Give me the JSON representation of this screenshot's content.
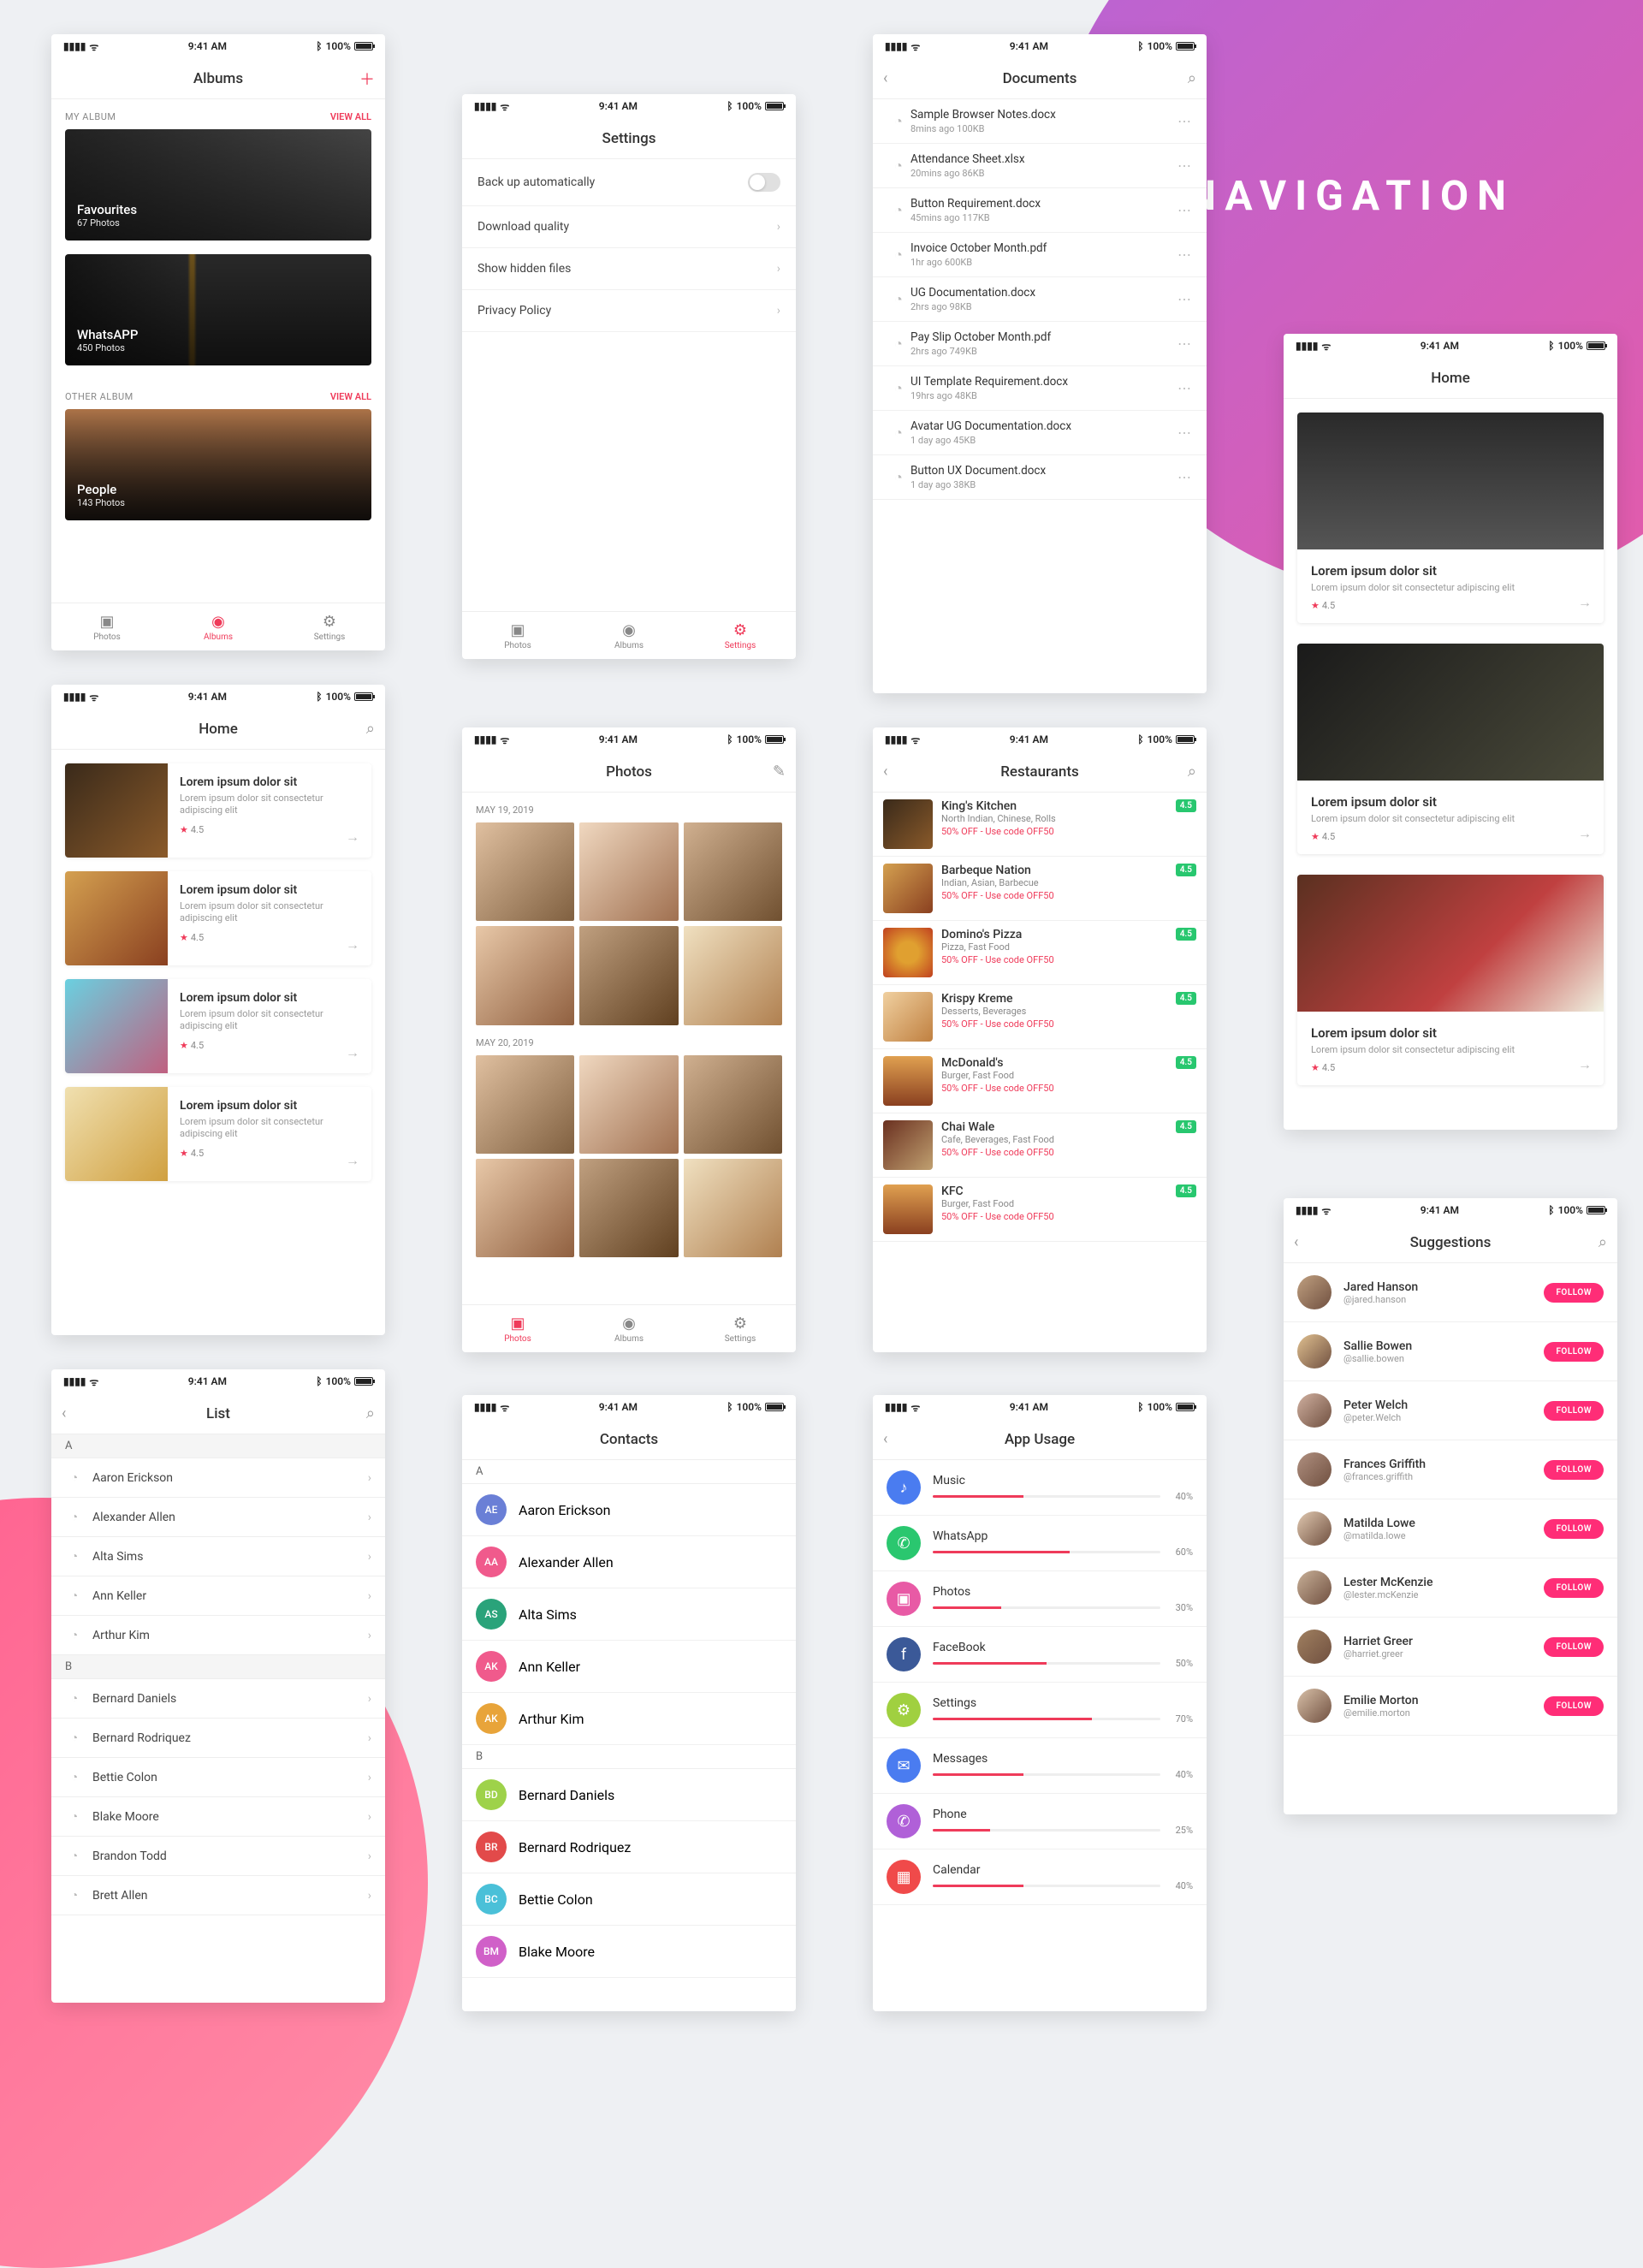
{
  "status": {
    "time": "9:41 AM",
    "battery": "100%"
  },
  "banner": "NAVIGATION",
  "tabs": {
    "photos": "Photos",
    "albums": "Albums",
    "settings": "Settings"
  },
  "albums": {
    "title": "Albums",
    "sect1": "MY ALBUM",
    "sect2": "OTHER ALBUM",
    "viewall": "VIEW ALL",
    "items": [
      {
        "t": "Favourites",
        "s": "67 Photos"
      },
      {
        "t": "WhatsAPP",
        "s": "450 Photos"
      },
      {
        "t": "People",
        "s": "143 Photos"
      }
    ]
  },
  "settings": {
    "title": "Settings",
    "rows": [
      "Back up automatically",
      "Download  quality",
      "Show hidden files",
      "Privacy Policy"
    ]
  },
  "documents": {
    "title": "Documents",
    "items": [
      {
        "t": "Sample Browser Notes.docx",
        "s": "8mins ago     100KB"
      },
      {
        "t": "Attendance Sheet.xlsx",
        "s": "20mins ago     86KB"
      },
      {
        "t": "Button Requirement.docx",
        "s": "45mins ago     117KB"
      },
      {
        "t": "Invoice October Month.pdf",
        "s": "1hr ago     600KB"
      },
      {
        "t": "UG Documentation.docx",
        "s": "2hrs ago     98KB"
      },
      {
        "t": "Pay Slip October Month.pdf",
        "s": "2hrs ago     749KB"
      },
      {
        "t": "UI Template Requirement.docx",
        "s": "19hrs ago     48KB"
      },
      {
        "t": "Avatar UG Documentation.docx",
        "s": "1 day ago     45KB"
      },
      {
        "t": "Button UX Document.docx",
        "s": "1 day ago     38KB"
      }
    ]
  },
  "home": {
    "title": "Home",
    "card_title": "Lorem ipsum dolor sit",
    "card_sub": "Lorem ipsum dolor sit consectetur adipiscing elit",
    "rating": "4.5"
  },
  "photos": {
    "title": "Photos",
    "d1": "MAY 19, 2019",
    "d2": "MAY 20, 2019"
  },
  "restaurants": {
    "title": "Restaurants",
    "offer": "50% OFF - Use code OFF50",
    "items": [
      {
        "t": "King's Kitchen",
        "s": "North Indian, Chinese, Rolls",
        "r": "4.5"
      },
      {
        "t": "Barbeque Nation",
        "s": "Indian, Asian, Barbecue",
        "r": "4.5"
      },
      {
        "t": "Domino's Pizza",
        "s": "Pizza, Fast Food",
        "r": "4.5"
      },
      {
        "t": "Krispy Kreme",
        "s": "Desserts, Beverages",
        "r": "4.5"
      },
      {
        "t": "McDonald's",
        "s": "Burger, Fast Food",
        "r": "4.5"
      },
      {
        "t": "Chai Wale",
        "s": "Cafe, Beverages, Fast Food",
        "r": "4.5"
      },
      {
        "t": "KFC",
        "s": "Burger, Fast Food",
        "r": "4.5"
      }
    ]
  },
  "list": {
    "title": "List",
    "A": [
      "Aaron Erickson",
      "Alexander Allen",
      "Alta Sims",
      "Ann Keller",
      "Arthur Kim"
    ],
    "B": [
      "Bernard Daniels",
      "Bernard Rodriquez",
      "Bettie Colon",
      "Blake Moore",
      "Brandon Todd",
      "Brett Allen"
    ]
  },
  "contacts": {
    "title": "Contacts",
    "A": [
      {
        "n": "Aaron Erickson",
        "i": "AE",
        "c": "#6a7fd6"
      },
      {
        "n": "Alexander Allen",
        "i": "AA",
        "c": "#f05a8c"
      },
      {
        "n": "Alta Sims",
        "i": "AS",
        "c": "#2aa37a"
      },
      {
        "n": "Ann Keller",
        "i": "AK",
        "c": "#f05a8c"
      },
      {
        "n": "Arthur Kim",
        "i": "AK",
        "c": "#e8a43a"
      }
    ],
    "B": [
      {
        "n": "Bernard Daniels",
        "i": "BD",
        "c": "#9ed24a"
      },
      {
        "n": "Bernard Rodriquez",
        "i": "BR",
        "c": "#e24a4a"
      },
      {
        "n": "Bettie Colon",
        "i": "BC",
        "c": "#4ac0d8"
      },
      {
        "n": "Blake Moore",
        "i": "BM",
        "c": "#d060c8"
      }
    ]
  },
  "usage": {
    "title": "App Usage",
    "items": [
      {
        "t": "Music",
        "p": 40,
        "c": "#4a7cf0"
      },
      {
        "t": "WhatsApp",
        "p": 60,
        "c": "#2ac76f"
      },
      {
        "t": "Photos",
        "p": 30,
        "c": "#e85aa5"
      },
      {
        "t": "FaceBook",
        "p": 50,
        "c": "#3b5998"
      },
      {
        "t": "Settings",
        "p": 70,
        "c": "#a0d040"
      },
      {
        "t": "Messages",
        "p": 40,
        "c": "#4a7cf0"
      },
      {
        "t": "Phone",
        "p": 25,
        "c": "#b060d8"
      },
      {
        "t": "Calendar",
        "p": 40,
        "c": "#f04a4a"
      }
    ]
  },
  "suggestions": {
    "title": "Suggestions",
    "follow": "FOLLOW",
    "items": [
      {
        "t": "Jared Hanson",
        "s": "@jared.hanson"
      },
      {
        "t": "Sallie Bowen",
        "s": "@sallie.bowen"
      },
      {
        "t": "Peter Welch",
        "s": "@peter.Welch"
      },
      {
        "t": "Frances Griffith",
        "s": "@frances.griffith"
      },
      {
        "t": "Matilda Lowe",
        "s": "@matilda.lowe"
      },
      {
        "t": "Lester McKenzie",
        "s": "@lester.mcKenzie"
      },
      {
        "t": "Harriet Greer",
        "s": "@harriet.greer"
      },
      {
        "t": "Emilie Morton",
        "s": "@emilie.morton"
      }
    ]
  }
}
